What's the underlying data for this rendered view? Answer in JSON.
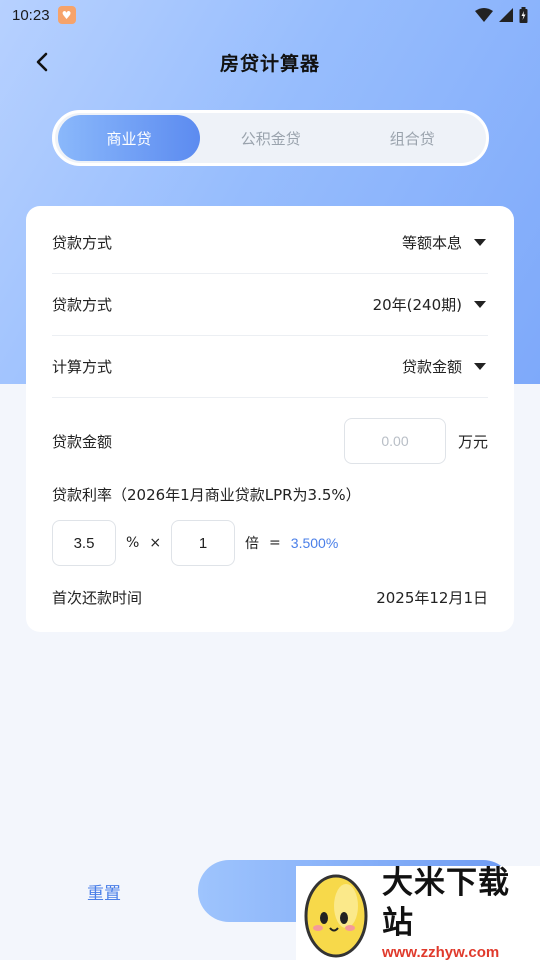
{
  "status_bar": {
    "time": "10:23"
  },
  "header": {
    "title": "房贷计算器"
  },
  "tabs": [
    {
      "label": "商业贷",
      "active": true
    },
    {
      "label": "公积金贷",
      "active": false
    },
    {
      "label": "组合贷",
      "active": false
    }
  ],
  "form": {
    "repayment_method": {
      "label": "贷款方式",
      "value": "等额本息"
    },
    "loan_term": {
      "label": "贷款方式",
      "value": "20年(240期)"
    },
    "calc_method": {
      "label": "计算方式",
      "value": "贷款金额"
    },
    "loan_amount": {
      "label": "贷款金额",
      "placeholder": "0.00",
      "unit": "万元"
    },
    "interest_rate": {
      "label": "贷款利率（2026年1月商业贷款LPR为3.5%）",
      "base_rate": "3.5",
      "percent_symbol": "%",
      "multiply_symbol": "×",
      "multiplier": "1",
      "multiplier_unit": "倍",
      "equals_symbol": "=",
      "result": "3.500%"
    },
    "first_payment": {
      "label": "首次还款时间",
      "value": "2025年12月1日"
    }
  },
  "bottom_bar": {
    "reset_label": "重置"
  },
  "watermark": {
    "title": "大米下载站",
    "url": "www.zzhyw.com"
  },
  "colors": {
    "accent": "#4a7fe8",
    "tab_active_start": "#8ab8fb",
    "tab_active_end": "#5c8bf0",
    "header_gradient_start": "#b7d1ff",
    "header_gradient_end": "#7ea9fa"
  }
}
